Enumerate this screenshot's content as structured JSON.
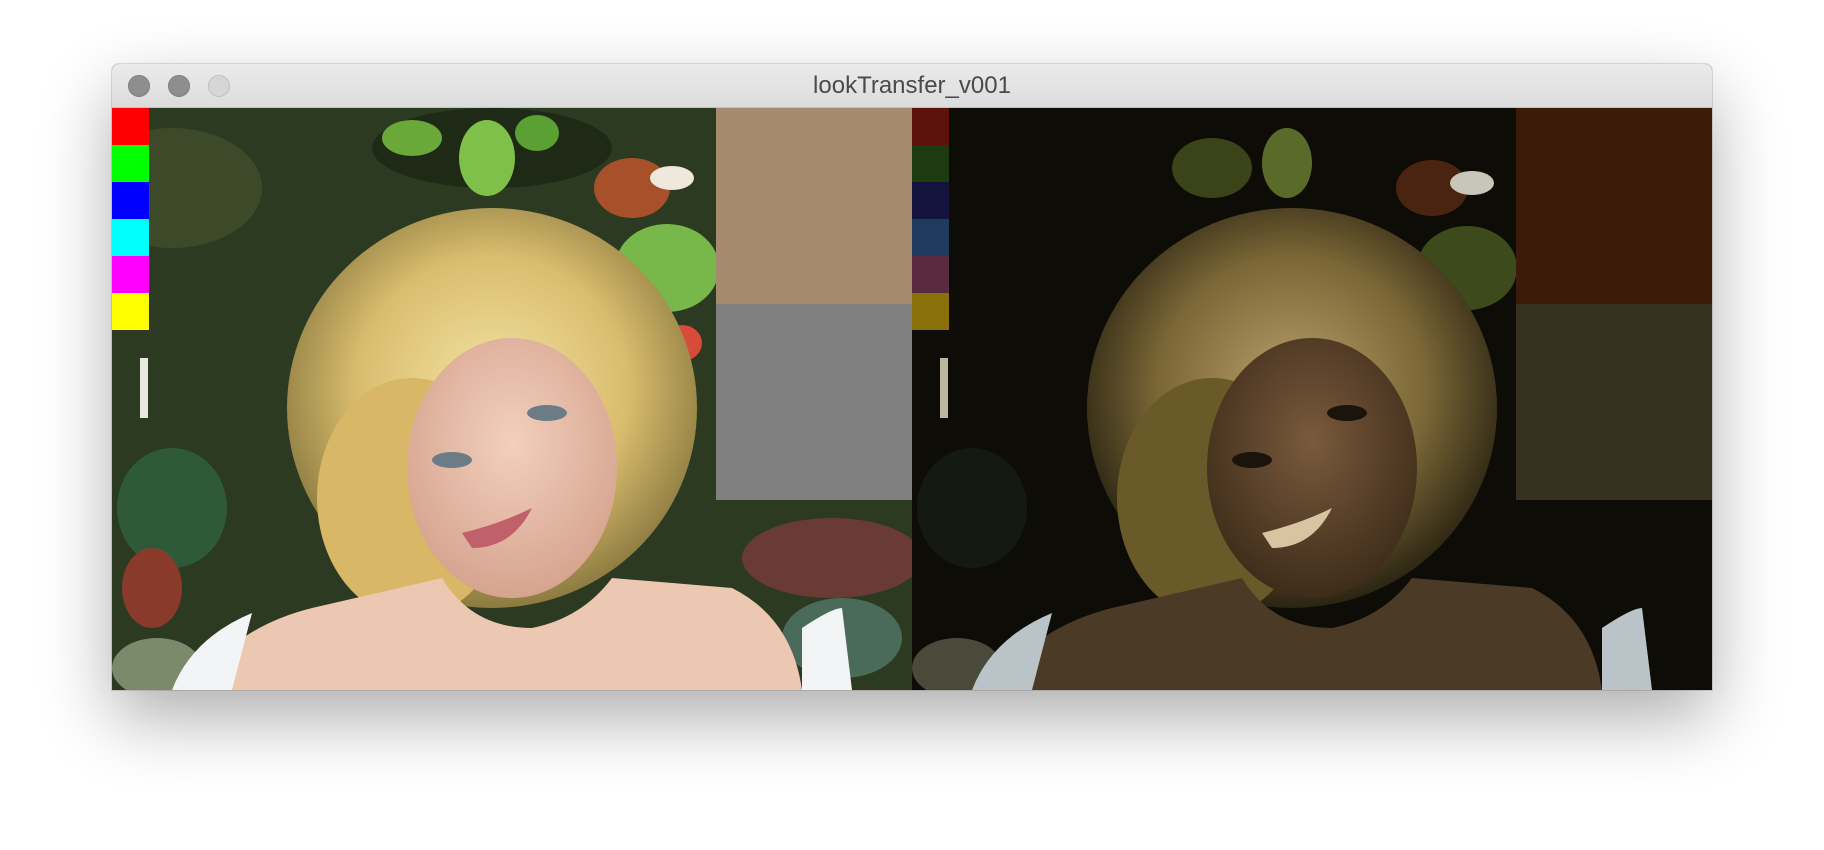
{
  "window": {
    "title": "lookTransfer_v001"
  },
  "left_panel": {
    "swatches": [
      "#ff0000",
      "#00ff00",
      "#0000ff",
      "#00ffff",
      "#ff00ff",
      "#ffff00"
    ],
    "sample_blocks": [
      "#a58a6d",
      "#808080"
    ],
    "image_subject": "portrait photo with foliage background"
  },
  "right_panel": {
    "swatches": [
      "#5c1208",
      "#1e3a10",
      "#13133d",
      "#1e3a5c",
      "#5a2a40",
      "#8a7008"
    ],
    "sample_blocks": [
      "#3c1c08",
      "#36301f"
    ],
    "image_subject": "color-transferred portrait photo, dark posterized look"
  }
}
